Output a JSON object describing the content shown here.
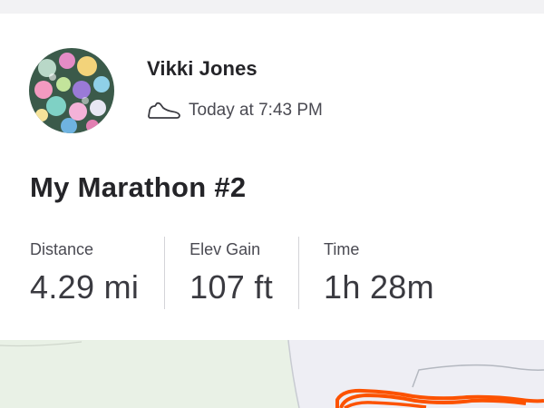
{
  "activity": {
    "athlete_name": "Vikki Jones",
    "timestamp": "Today at 7:43 PM",
    "sport_icon": "running-shoe-icon",
    "title": "My Marathon #2"
  },
  "stats": [
    {
      "label": "Distance",
      "value": "4.29 mi"
    },
    {
      "label": "Elev Gain",
      "value": "107 ft"
    },
    {
      "label": "Time",
      "value": "1h 28m"
    }
  ],
  "colors": {
    "route": "#fc5200",
    "map_land": "#e9f1e6",
    "map_area": "#eeeef4",
    "text_primary": "#242428",
    "text_secondary": "#4a4a52"
  }
}
